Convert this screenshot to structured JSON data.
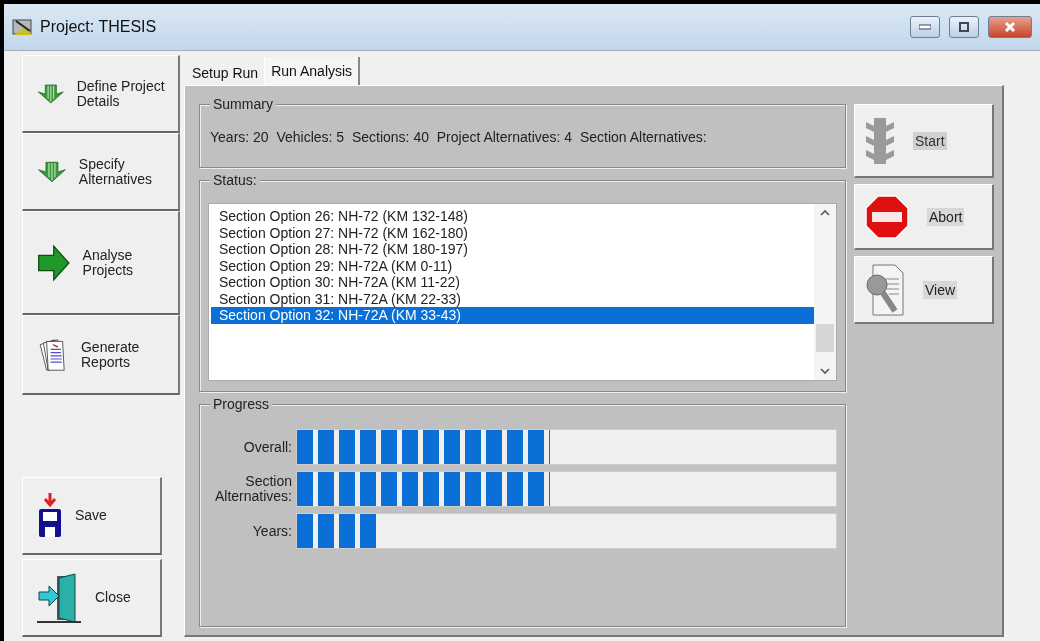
{
  "window": {
    "title": "Project: THESIS"
  },
  "sidebar": {
    "items": [
      {
        "label": "Define Project Details"
      },
      {
        "label": "Specify Alternatives"
      },
      {
        "label": "Analyse Projects"
      },
      {
        "label": "Generate Reports"
      }
    ],
    "bottom_buttons": [
      {
        "label": "Save"
      },
      {
        "label": "Close"
      }
    ]
  },
  "tabs": [
    {
      "label": "Setup Run",
      "selected": false
    },
    {
      "label": "Run Analysis",
      "selected": true
    }
  ],
  "summary": {
    "title": "Summary",
    "text": "Years: 20  Vehicles: 5  Sections: 40  Project Alternatives: 4  Section Alternatives:"
  },
  "status": {
    "title": "Status:",
    "items": [
      {
        "label": "Section Option 26: NH-72 (KM 132-148)",
        "selected": false
      },
      {
        "label": "Section Option 27: NH-72 (KM 162-180)",
        "selected": false
      },
      {
        "label": "Section Option 28: NH-72 (KM 180-197)",
        "selected": false
      },
      {
        "label": "Section Option 29: NH-72A (KM 0-11)",
        "selected": false
      },
      {
        "label": "Section Option 30: NH-72A (KM 11-22)",
        "selected": false
      },
      {
        "label": "Section Option 31: NH-72A (KM 22-33)",
        "selected": false
      },
      {
        "label": "Section Option 32: NH-72A (KM 33-43)",
        "selected": true
      }
    ]
  },
  "progress": {
    "title": "Progress",
    "bars": [
      {
        "label": "Overall:",
        "level": 0.47
      },
      {
        "label": "Section Alternatives:",
        "level": 0.47
      },
      {
        "label": "Years:",
        "level": 0.15
      }
    ]
  },
  "actions": [
    {
      "label": "Start",
      "disabled": true
    },
    {
      "label": "Abort",
      "disabled": false
    },
    {
      "label": "View",
      "disabled": false
    }
  ]
}
